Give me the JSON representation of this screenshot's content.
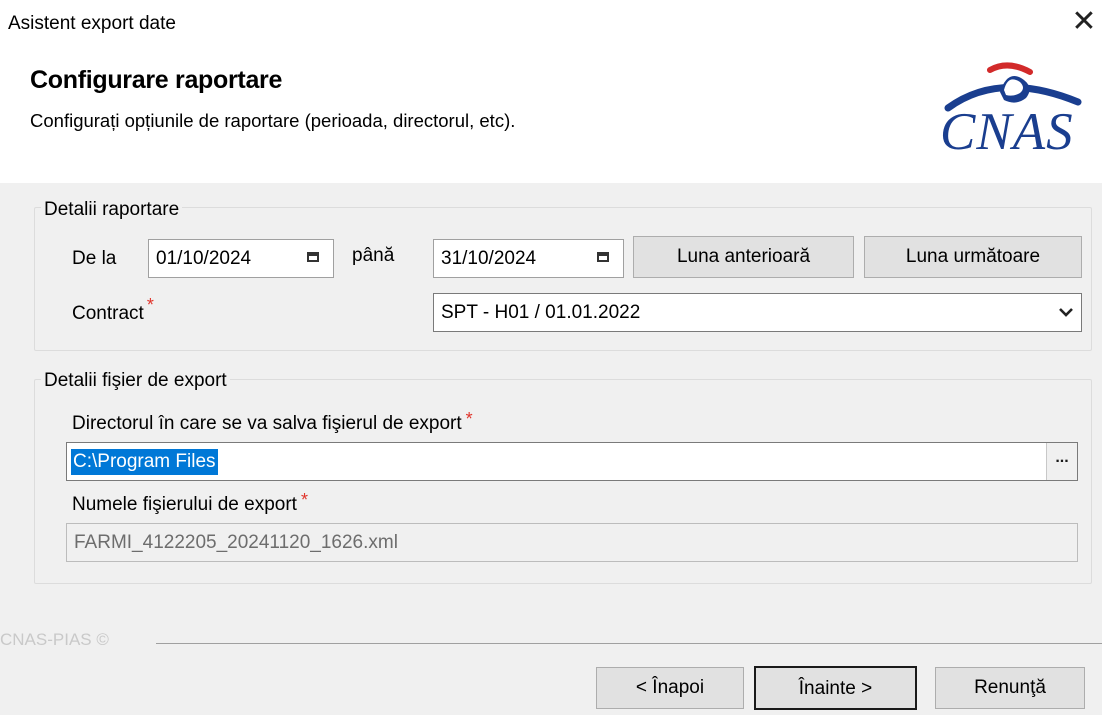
{
  "window": {
    "title": "Asistent export date",
    "close_glyph": "✕"
  },
  "header": {
    "title": "Configurare raportare",
    "subtitle": "Configurați opțiunile de raportare (perioada, directorul, etc).",
    "logo_text": "CNAS",
    "logo_color": "#1a3e8f",
    "logo_accent_color": "#d22a2a"
  },
  "report_details": {
    "group_label": "Detalii raportare",
    "from_label": "De la",
    "from_value": "01/10/2024",
    "to_label": "până",
    "to_value": "31/10/2024",
    "prev_month_label": "Luna anterioară",
    "next_month_label": "Luna următoare",
    "contract_label": "Contract",
    "contract_required": "*",
    "contract_value": "SPT - H01 / 01.01.2022"
  },
  "export_details": {
    "group_label": "Detalii fişier de export",
    "directory_label": "Directorul în care se va salva fişierul de export",
    "directory_required": "*",
    "directory_value": "C:\\Program Files",
    "browse_label": "...",
    "filename_label": "Numele fişierului de export",
    "filename_required": "*",
    "filename_value": "FARMI_4122205_20241120_1626.xml"
  },
  "footer": {
    "brand": "CNAS-PIAS ©",
    "back_label": "< Înapoi",
    "next_label": "Înainte >",
    "cancel_label": "Renunţă"
  },
  "colors": {
    "selection": "#0078d7",
    "required": "#e0342b",
    "panel": "#f0f0f0"
  }
}
